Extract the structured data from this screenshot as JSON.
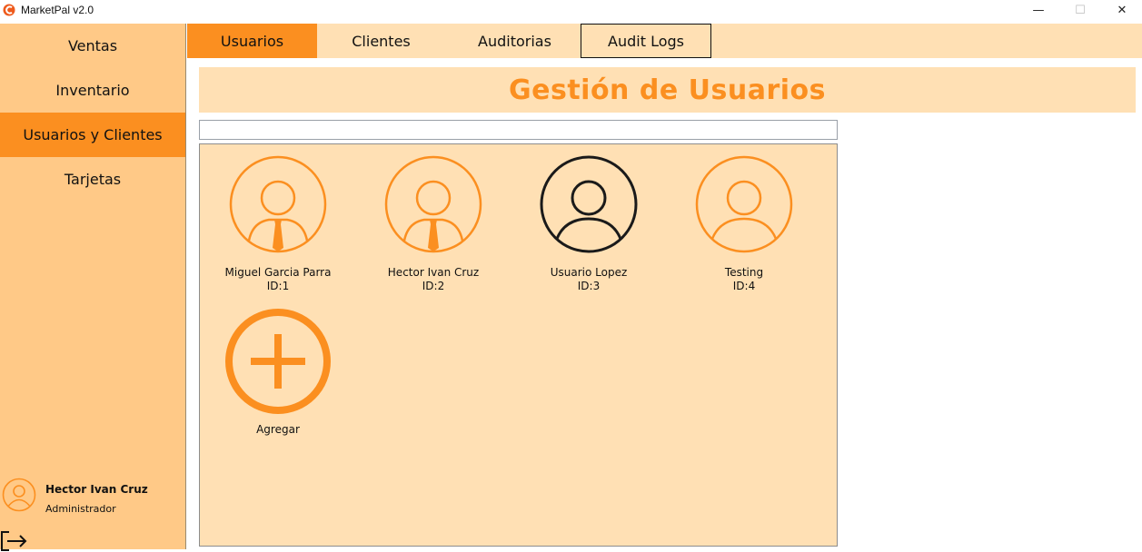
{
  "window": {
    "title": "MarketPal v2.0",
    "minimize": "—",
    "maximize": "☐",
    "close": "✕"
  },
  "sidebar": {
    "items": [
      {
        "label": "Ventas"
      },
      {
        "label": "Inventario"
      },
      {
        "label": "Usuarios y Clientes",
        "active": true
      },
      {
        "label": "Tarjetas"
      }
    ],
    "user": {
      "name": "Hector Ivan Cruz",
      "role": "Administrador"
    }
  },
  "tabs": [
    {
      "label": "Usuarios",
      "active": true
    },
    {
      "label": "Clientes"
    },
    {
      "label": "Auditorias"
    },
    {
      "label": "Audit Logs"
    }
  ],
  "page": {
    "title": "Gestión de Usuarios",
    "search_value": ""
  },
  "users": [
    {
      "name": "Miguel Garcia Parra",
      "id": "ID:1",
      "icon": "user-tie-icon"
    },
    {
      "name": "Hector Ivan Cruz",
      "id": "ID:2",
      "icon": "user-tie-icon"
    },
    {
      "name": "Usuario Lopez",
      "id": "ID:3",
      "icon": "user-icon"
    },
    {
      "name": "Testing",
      "id": "ID:4",
      "icon": "user-icon"
    }
  ],
  "add": {
    "label": "Agregar",
    "icon": "plus-circle-icon"
  },
  "colors": {
    "accent": "#fb8f20",
    "sidebar_bg": "#ffc987",
    "panel_bg": "#ffe0b4",
    "dark_icon": "#1a1a1a"
  }
}
